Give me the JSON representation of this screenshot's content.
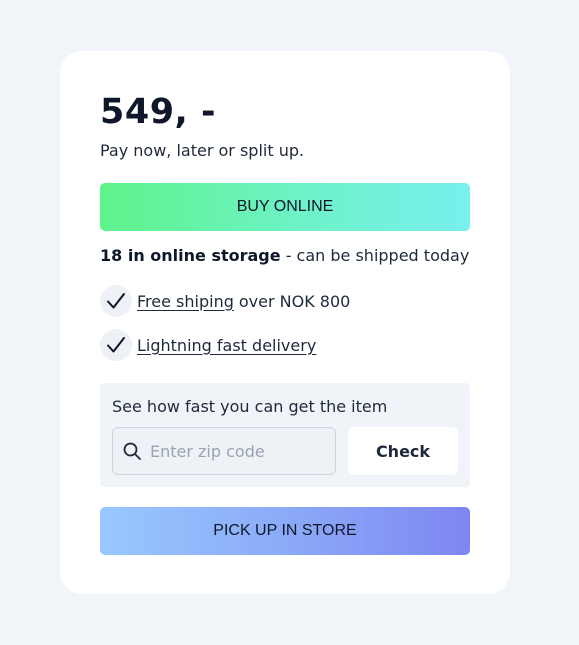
{
  "price": {
    "amount": "549, -",
    "subtitle": "Pay now, later or split up."
  },
  "buy_button": {
    "label": "BUY ONLINE"
  },
  "stock": {
    "bold": "18 in online storage",
    "rest": " - can be shipped today"
  },
  "features": [
    {
      "link": "Free shiping",
      "rest": "over NOK 800",
      "icon": "checkmark-icon"
    },
    {
      "link": "Lightning fast delivery",
      "rest": "",
      "icon": "checkmark-icon"
    }
  ],
  "zip": {
    "title": "See how fast you can get the item",
    "placeholder": "Enter zip code",
    "value": "",
    "check_label": "Check",
    "icon": "search-icon"
  },
  "pickup_button": {
    "label": "PICK UP IN STORE"
  },
  "colors": {
    "background": "#f1f4f8",
    "card": "#ffffff",
    "buy_gradient": [
      "#5ef28a",
      "#78f0ee"
    ],
    "pickup_gradient": [
      "#99c8fd",
      "#7e86f1"
    ]
  }
}
